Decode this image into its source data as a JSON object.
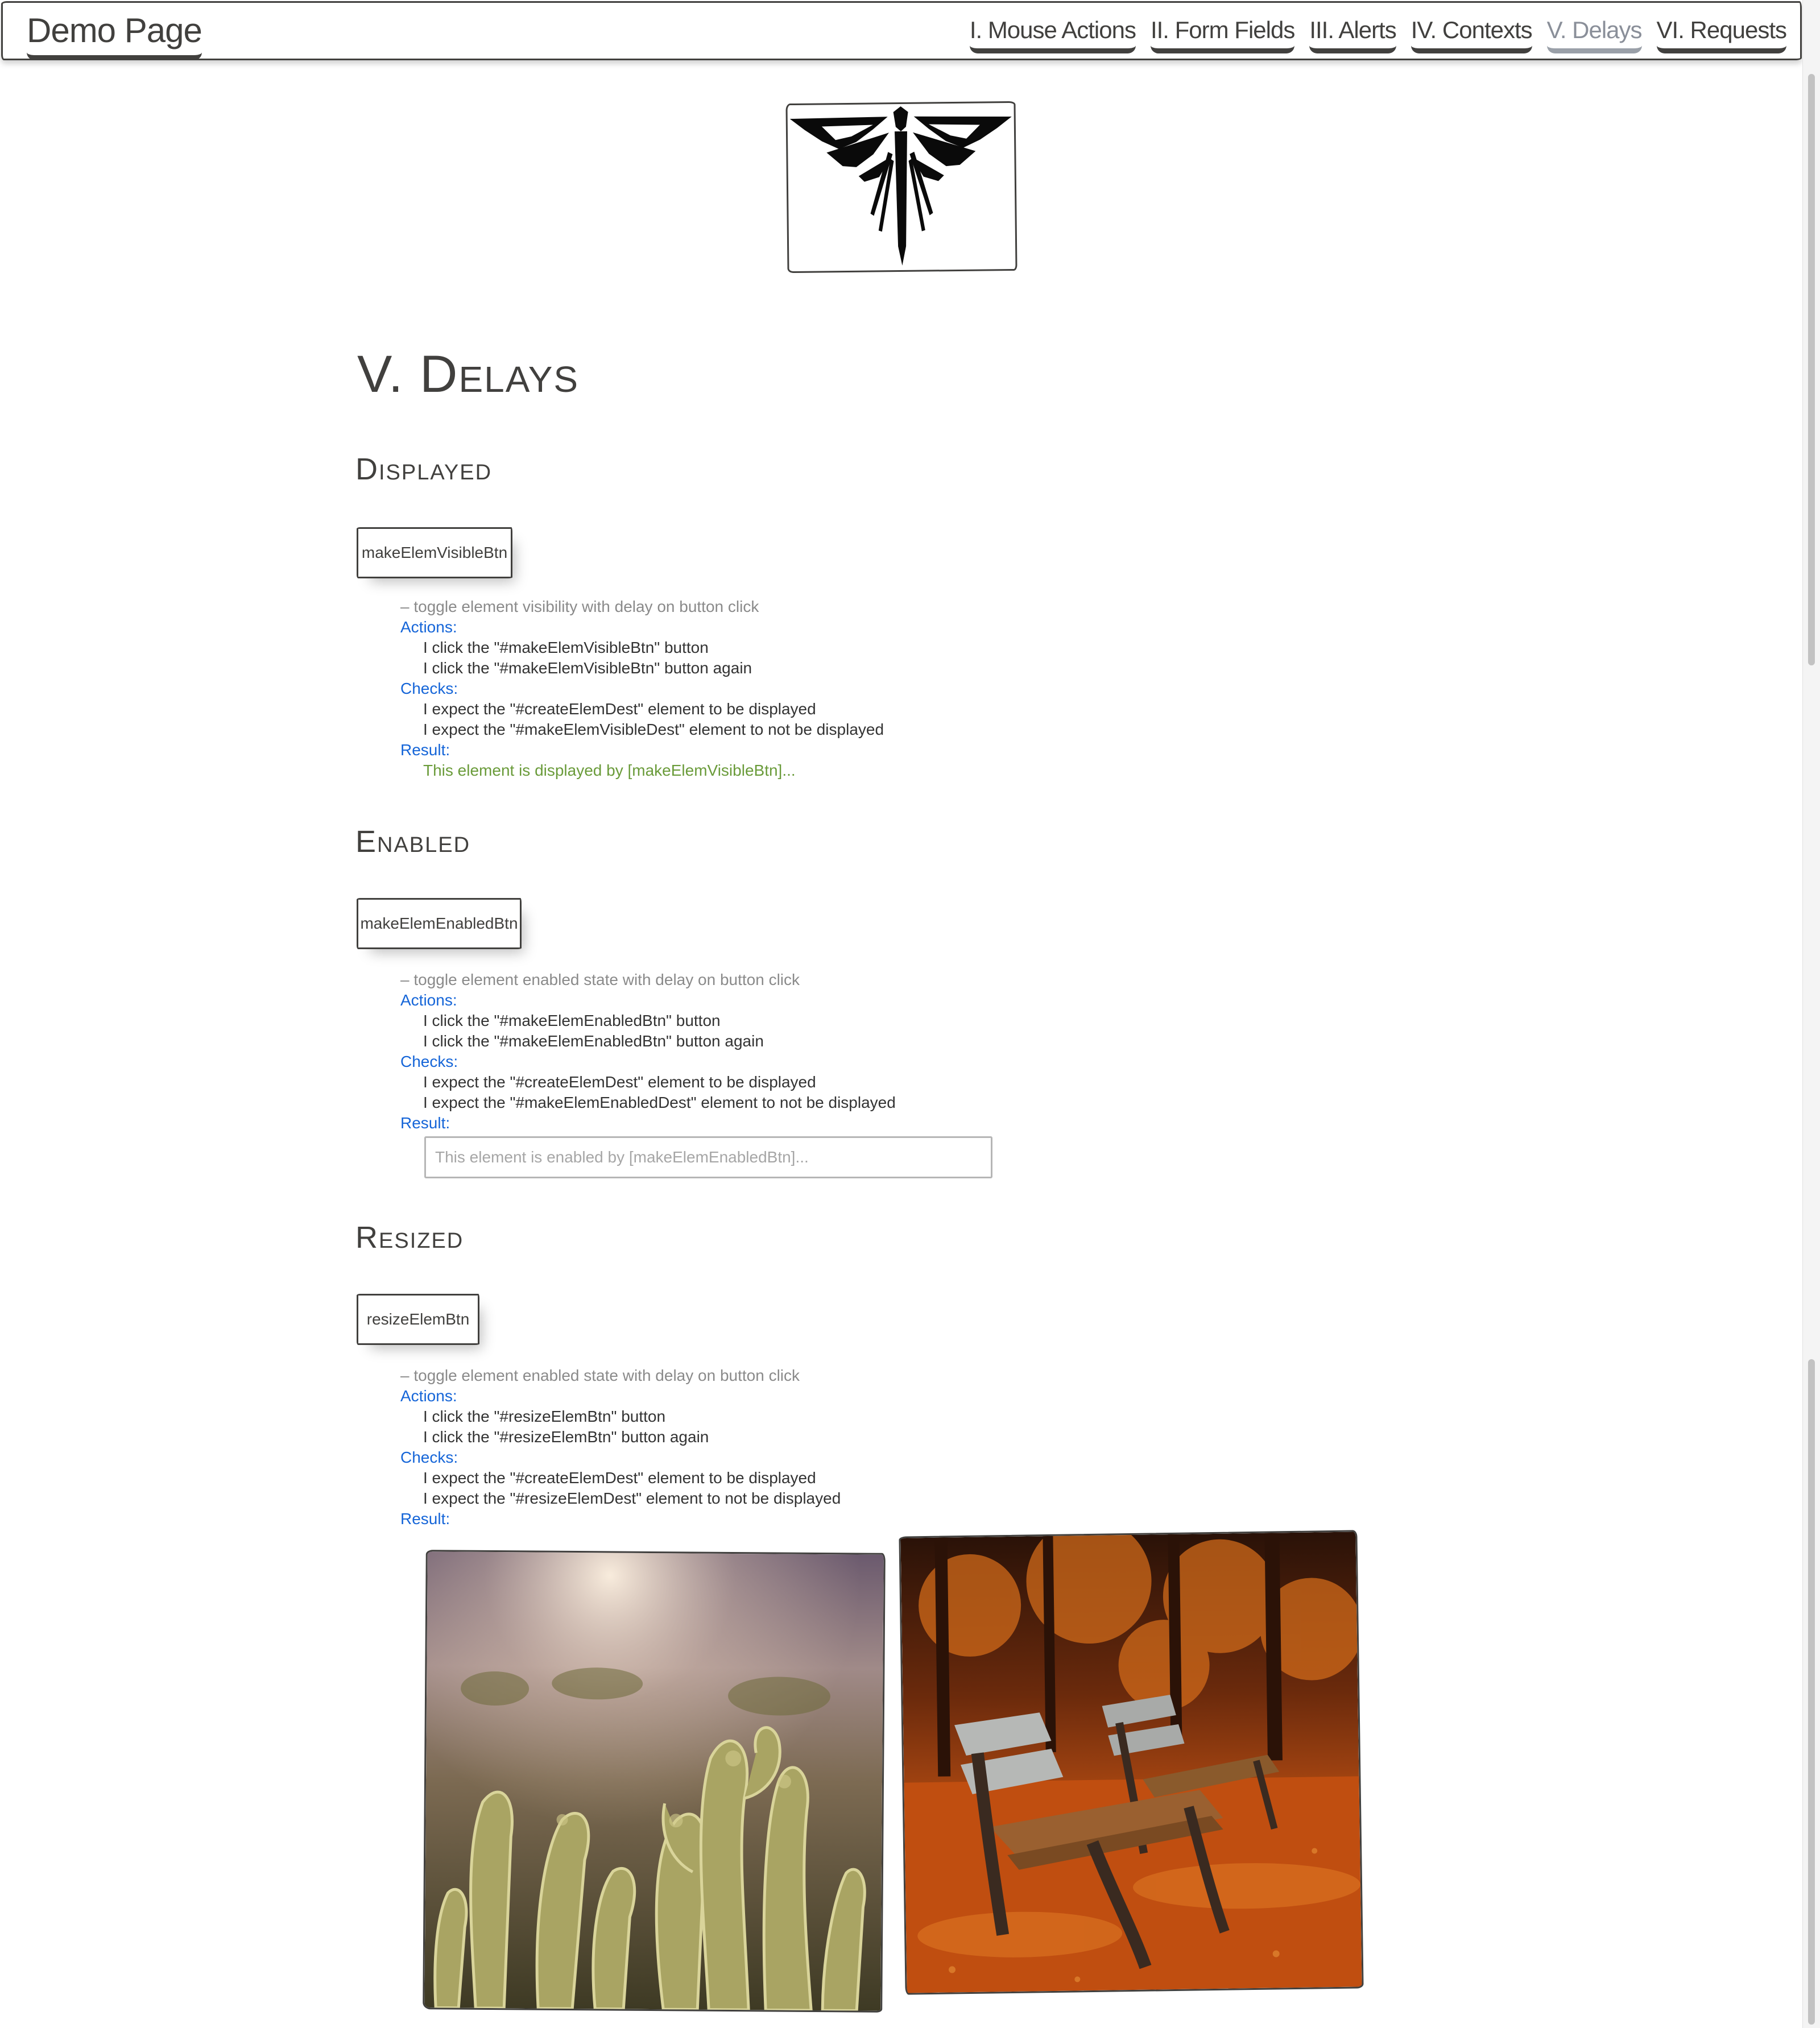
{
  "navbar": {
    "brand": "Demo Page",
    "items": [
      {
        "label": "I. Mouse Actions"
      },
      {
        "label": "II. Form Fields"
      },
      {
        "label": "III. Alerts"
      },
      {
        "label": "IV. Contexts"
      },
      {
        "label": "V. Delays",
        "active": true
      },
      {
        "label": "VI. Requests"
      }
    ]
  },
  "logo": {
    "icon": "firefly-emblem-icon"
  },
  "page": {
    "title": "V. Delays"
  },
  "sections": {
    "displayed": {
      "title": "Displayed",
      "button": "makeElemVisibleBtn",
      "description": "– toggle element visibility with delay on button click",
      "actions_label": "Actions:",
      "actions": [
        "I click the \"#makeElemVisibleBtn\" button",
        "I click the \"#makeElemVisibleBtn\" button again"
      ],
      "checks_label": "Checks:",
      "checks": [
        "I expect the \"#createElemDest\" element to be displayed",
        "I expect the \"#makeElemVisibleDest\" element to not be displayed"
      ],
      "result_label": "Result:",
      "result_text": "This element is displayed by [makeElemVisibleBtn]..."
    },
    "enabled": {
      "title": "Enabled",
      "button": "makeElemEnabledBtn",
      "description": "– toggle element enabled state with delay on button click",
      "actions_label": "Actions:",
      "actions": [
        "I click the \"#makeElemEnabledBtn\" button",
        "I click the \"#makeElemEnabledBtn\" button again"
      ],
      "checks_label": "Checks:",
      "checks": [
        "I expect the \"#createElemDest\" element to be displayed",
        "I expect the \"#makeElemEnabledDest\" element to not be displayed"
      ],
      "result_label": "Result:",
      "result_placeholder": "This element is enabled by [makeElemEnabledBtn]..."
    },
    "resized": {
      "title": "Resized",
      "button": "resizeElemBtn",
      "description": "– toggle element enabled state with delay on button click",
      "actions_label": "Actions:",
      "actions": [
        "I click the \"#resizeElemBtn\" button",
        "I click the \"#resizeElemBtn\" button again"
      ],
      "checks_label": "Checks:",
      "checks": [
        "I expect the \"#createElemDest\" element to be displayed",
        "I expect the \"#resizeElemDest\" element to not be displayed"
      ],
      "result_label": "Result:"
    }
  },
  "images": [
    {
      "subject": "cactus-photo"
    },
    {
      "subject": "autumn-bench-photo"
    }
  ],
  "colors": {
    "ink": "#41403e",
    "label_blue": "#1565d8",
    "result_green": "#6a9b3a",
    "muted": "#8a8a8a"
  }
}
